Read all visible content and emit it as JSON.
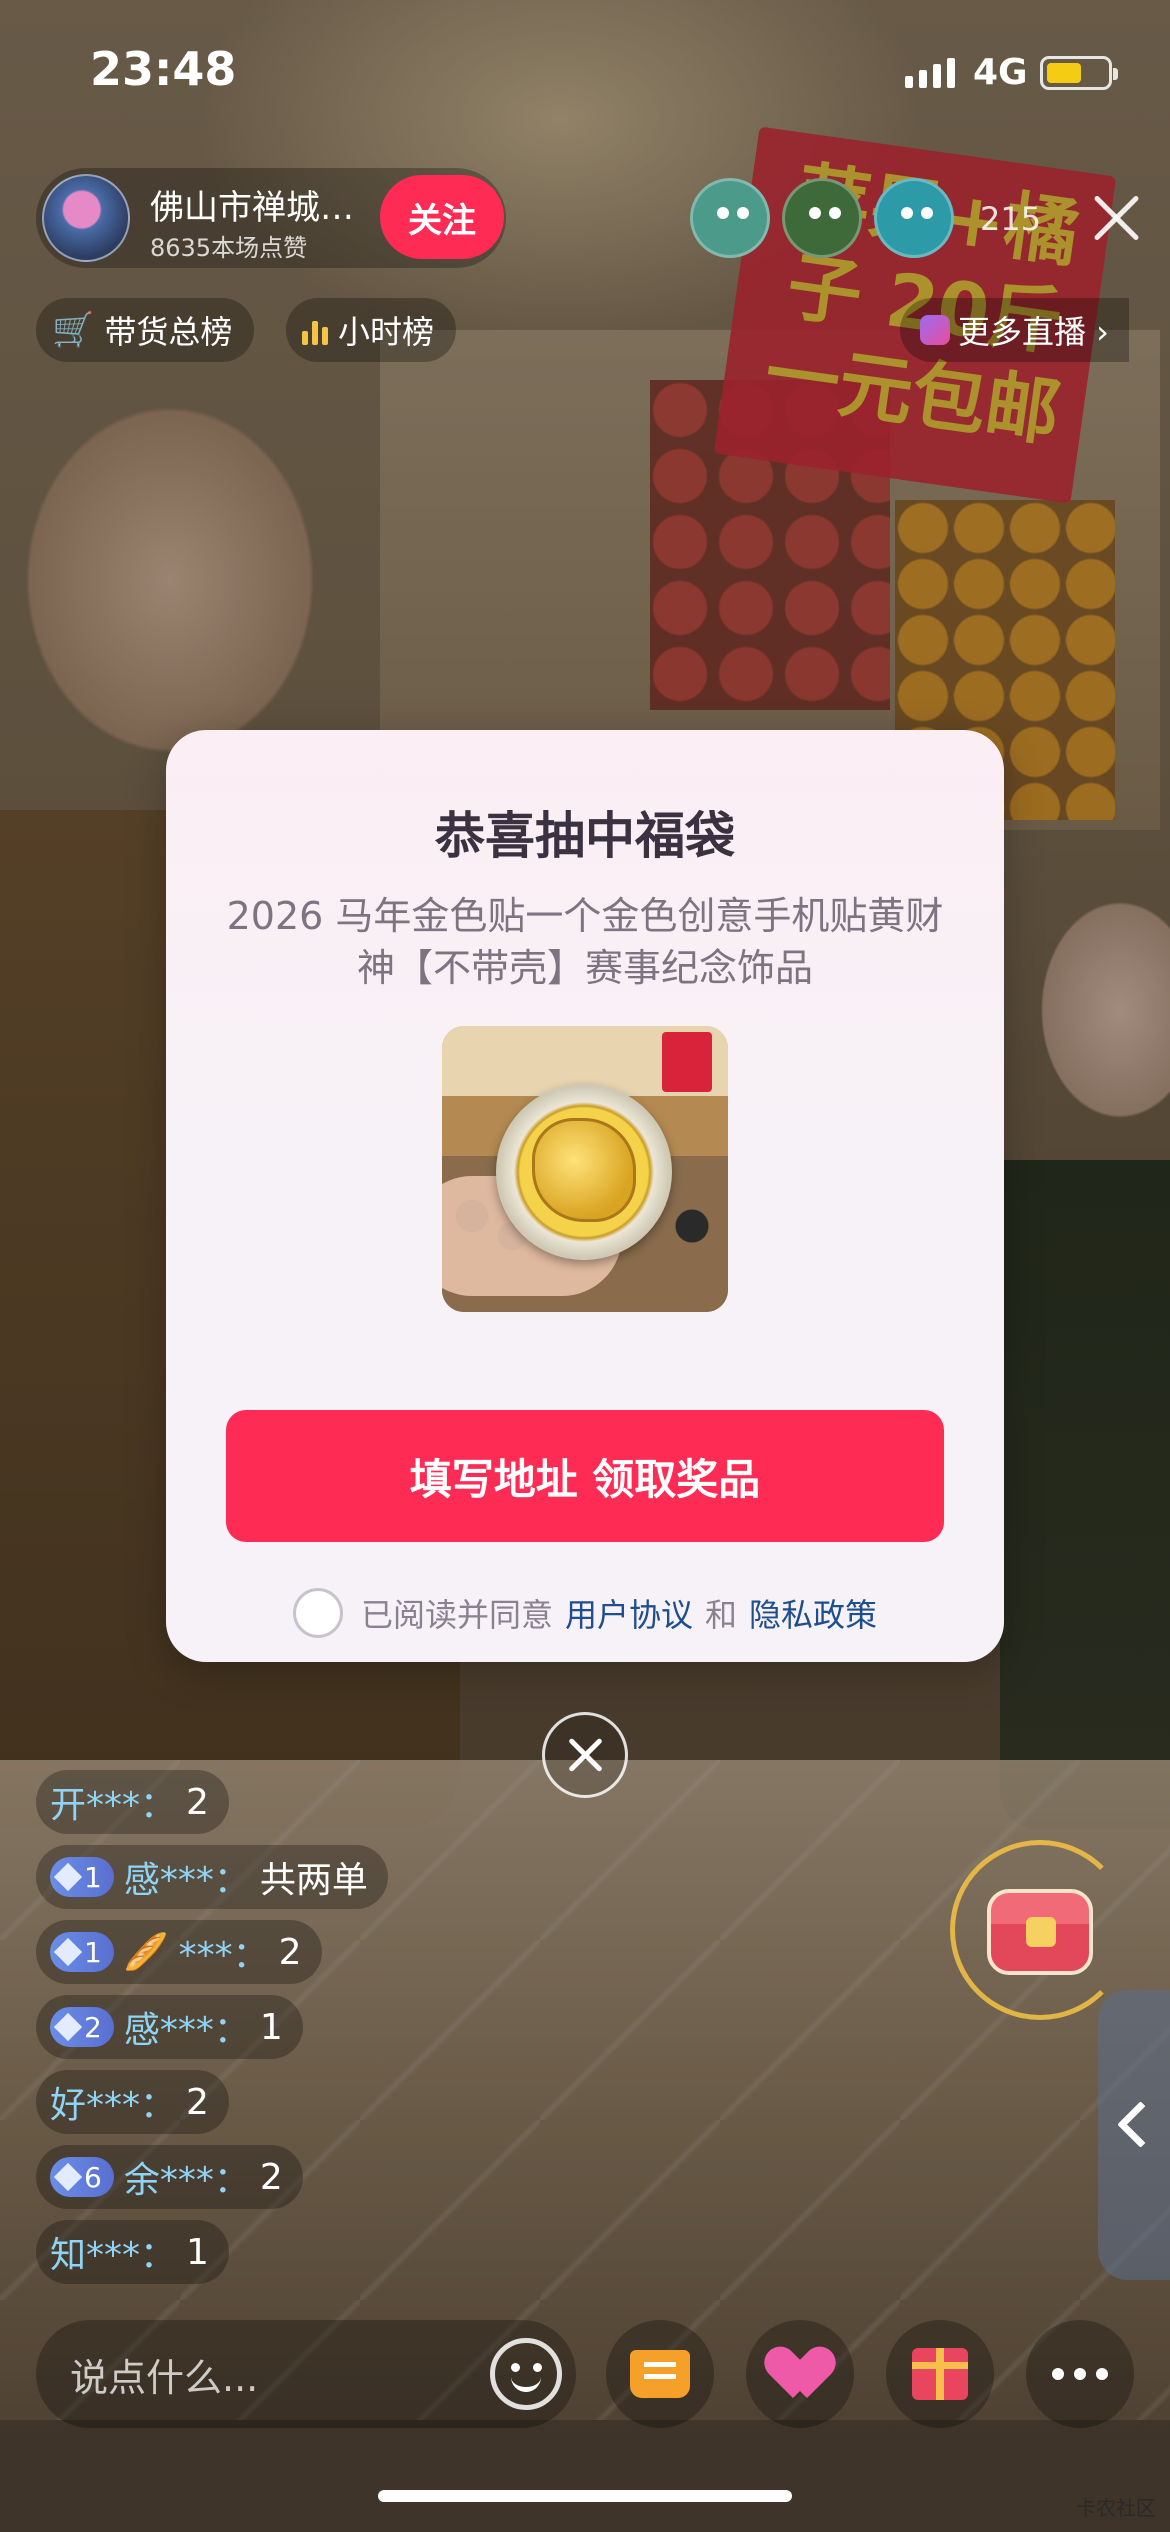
{
  "status_bar": {
    "time": "23:48",
    "network": "4G"
  },
  "header": {
    "host_name": "佛山市禅城…",
    "host_likes": "8635本场点赞",
    "follow_label": "关注",
    "viewer_count": "215",
    "rank_goods_label": "带货总榜",
    "rank_hour_label": "小时榜",
    "more_live_label": "更多直播 ›"
  },
  "background_sign": {
    "text": "苹果+橘子 20斤 一元包邮"
  },
  "modal": {
    "title": "恭喜抽中福袋",
    "prize_name": "2026 马年金色贴一个金色创意手机贴黄财神【不带壳】赛事纪念饰品",
    "claim_button": "填写地址 领取奖品",
    "agree_prefix": "已阅读并同意",
    "agree_link_1": "用户协议",
    "agree_and": "和",
    "agree_link_2": "隐私政策"
  },
  "comments": [
    {
      "badge": "",
      "name": "开***：",
      "text": "2"
    },
    {
      "badge": "1",
      "name": "感***：",
      "text": "共两单"
    },
    {
      "badge": "1",
      "emoji": "🥖",
      "name": "***：",
      "text": "2"
    },
    {
      "badge": "2",
      "name": "感***：",
      "text": "1"
    },
    {
      "badge": "",
      "name": "好***：",
      "text": "2"
    },
    {
      "badge": "6",
      "name": "余***：",
      "text": "2"
    },
    {
      "badge": "",
      "name": "知***：",
      "text": "1"
    }
  ],
  "bottom_bar": {
    "input_placeholder": "说点什么..."
  },
  "watermark": "卡农社区",
  "colors": {
    "accent": "#fe2c55",
    "link": "#1f4e8e",
    "name_color": "#8fd3f5"
  }
}
